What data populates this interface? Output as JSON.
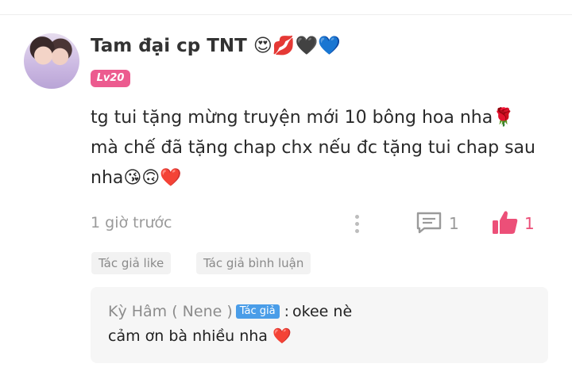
{
  "comment": {
    "username": "Tam đại cp TNT",
    "username_emojis": "😍💋🖤💙",
    "level": "Lv20",
    "text_lines": [
      "tg tui tặng mừng truyện mới 10 bông hoa nha🌹",
      "mà chế đã tặng chap chx nếu đc tặng tui chap sau",
      "nha😘🙃❤️"
    ],
    "time": "1 giờ trước",
    "reply_count": "1",
    "like_count": "1",
    "icons": {
      "more": "more-vertical-icon",
      "reply": "comment-icon",
      "like": "thumbs-up-icon"
    },
    "colors": {
      "level_badge": "#ec5b8f",
      "like": "#ec4f78",
      "author_badge": "#4a9de8"
    }
  },
  "tags": {
    "author_liked": "Tác giả like",
    "author_commented": "Tác giả bình luận"
  },
  "reply": {
    "author": "Kỳ Hâm ( Nene )",
    "author_badge": "Tác giả",
    "separator": ":",
    "line1": "okee nè",
    "line2": "cảm ơn bà nhiều nha ❤️"
  }
}
